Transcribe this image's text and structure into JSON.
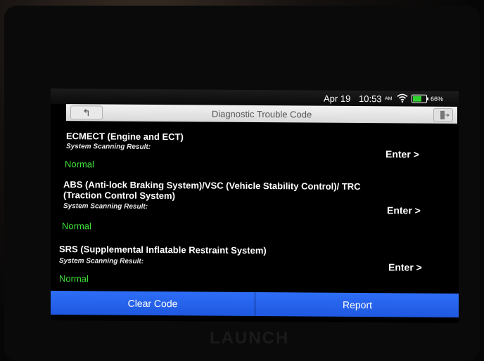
{
  "status_bar": {
    "date": "Apr 19",
    "time": "10:53",
    "ampm": "AM",
    "battery_percent": "66%",
    "battery_level": 0.66
  },
  "title_bar": {
    "title": "Diagnostic Trouble Code",
    "back_icon": "back-arrow-icon",
    "exit_icon": "exit-door-icon"
  },
  "systems": [
    {
      "name": "ECMECT (Engine and ECT)",
      "label": "System Scanning Result:",
      "status": "Normal",
      "action": "Enter >"
    },
    {
      "name": "ABS (Anti-lock Braking System)/VSC (Vehicle Stability Control)/ TRC (Traction Control System)",
      "label": "System Scanning Result:",
      "status": "Normal",
      "action": "Enter >"
    },
    {
      "name": "SRS (Supplemental Inflatable Restraint System)",
      "label": "System Scanning Result:",
      "status": "Normal",
      "action": "Enter >"
    }
  ],
  "bottom_bar": {
    "clear_code": "Clear Code",
    "report": "Report"
  },
  "colors": {
    "status_ok": "#3ee23a",
    "button_blue": "#2563eb"
  },
  "device_brand": "LAUNCH"
}
